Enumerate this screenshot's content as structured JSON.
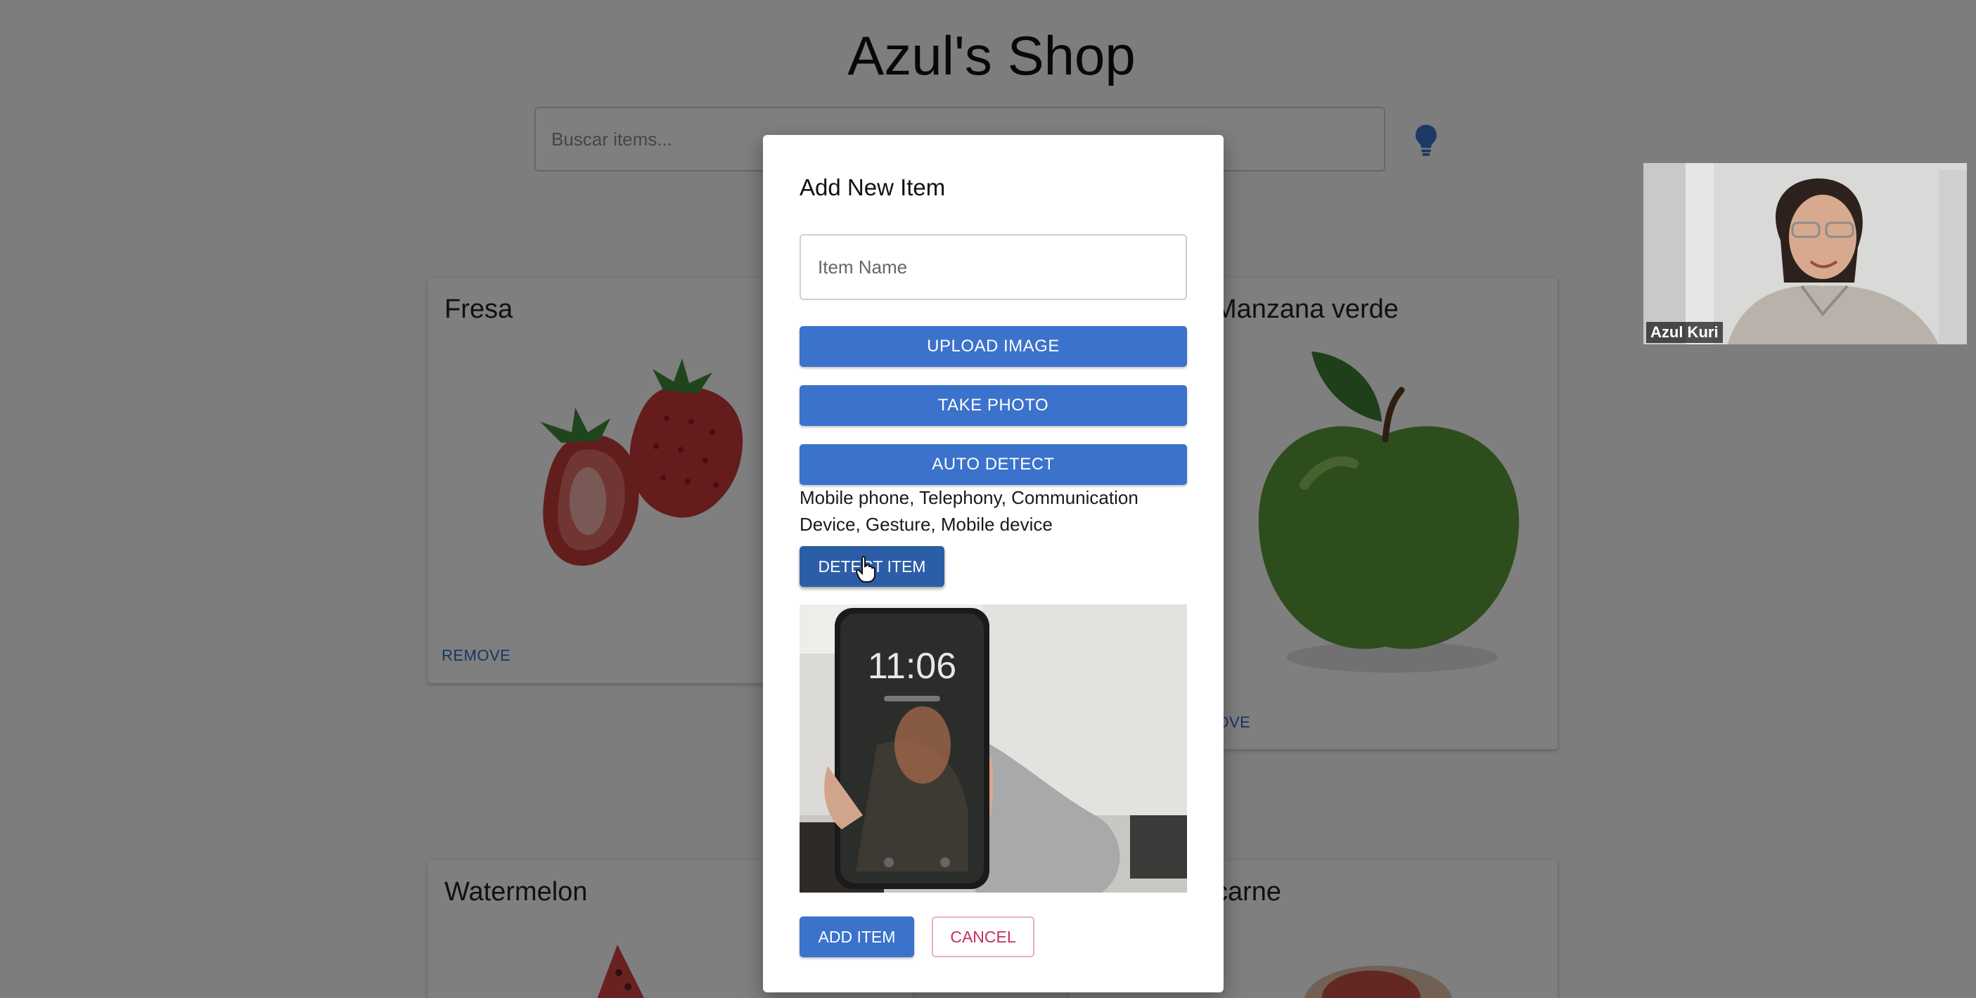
{
  "page": {
    "title": "Azul's Shop",
    "search_placeholder": "Buscar items..."
  },
  "cards": [
    {
      "title": "Fresa",
      "remove_label": "REMOVE"
    },
    {
      "title": "Manzana verde",
      "remove_label": "REMOVE"
    },
    {
      "title": "Watermelon"
    },
    {
      "title": "carne"
    }
  ],
  "icons": {
    "bulb": "lightbulb-icon",
    "cursor": "hand-cursor-icon"
  },
  "modal": {
    "title": "Add New Item",
    "item_name_placeholder": "Item Name",
    "upload_label": "UPLOAD IMAGE",
    "take_photo_label": "TAKE PHOTO",
    "auto_detect_label": "AUTO DETECT",
    "detected_labels": "Mobile phone, Telephony, Communication Device, Gesture, Mobile device",
    "detect_item_label": "DETECT ITEM",
    "add_item_label": "ADD ITEM",
    "cancel_label": "CANCEL",
    "photo_time": "11:06"
  },
  "webcam": {
    "participant_name": "Azul Kuri"
  },
  "colors": {
    "primary": "#3b72cc",
    "cancel": "#c4305b",
    "overlay": "rgba(0,0,0,0.5)"
  }
}
